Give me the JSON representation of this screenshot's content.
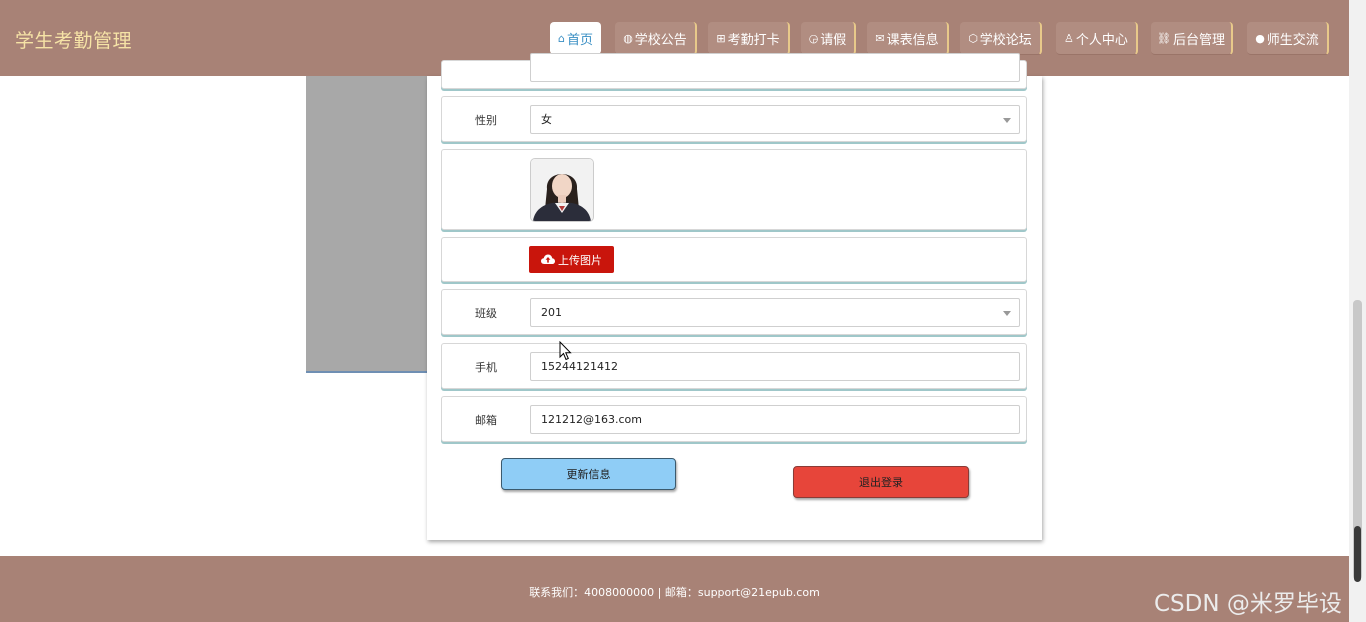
{
  "header": {
    "title": "学生考勤管理",
    "nav": [
      {
        "icon": "⌂",
        "label": "首页"
      },
      {
        "icon": "◍",
        "label": "学校公告"
      },
      {
        "icon": "⊞",
        "label": "考勤打卡"
      },
      {
        "icon": "◶",
        "label": "请假"
      },
      {
        "icon": "✉",
        "label": "课表信息"
      },
      {
        "icon": "⬡",
        "label": "学校论坛"
      },
      {
        "icon": "♙",
        "label": "个人中心"
      },
      {
        "icon": "⛓",
        "label": "后台管理"
      },
      {
        "icon": "●",
        "label": "师生交流"
      }
    ]
  },
  "form": {
    "gender_label": "性别",
    "gender_value": "女",
    "upload_label": "上传图片",
    "class_label": "班级",
    "class_value": "201",
    "phone_label": "手机",
    "phone_value": "15244121412",
    "email_label": "邮箱",
    "email_value": "121212@163.com",
    "update_button": "更新信息",
    "logout_button": "退出登录"
  },
  "footer": {
    "text": "联系我们：4008000000 | 邮箱：support@21epub.com"
  },
  "watermark": "CSDN @米罗毕设",
  "colors": {
    "header_bg": "#a88276",
    "brand_text": "#f6e3a6",
    "upload_button": "#c9150c",
    "update_button": "#8fcdf6",
    "logout_button": "#e7453a"
  }
}
